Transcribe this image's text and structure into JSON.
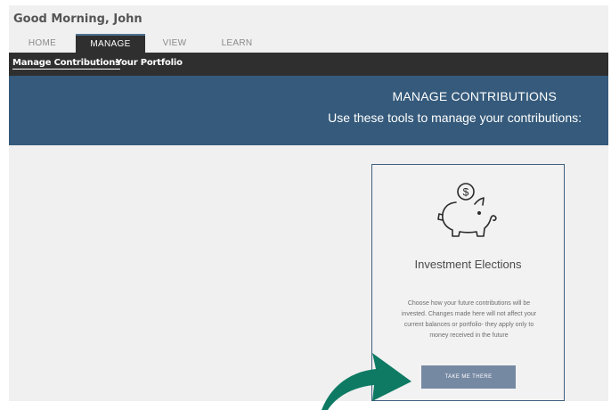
{
  "header": {
    "greeting": "Good Morning, John"
  },
  "tabs": [
    {
      "label": "HOME"
    },
    {
      "label": "MANAGE",
      "active": true
    },
    {
      "label": "VIEW"
    },
    {
      "label": "LEARN"
    }
  ],
  "subnav": [
    {
      "label": "Manage Contributions",
      "active": true
    },
    {
      "label": "Your Portfolio"
    }
  ],
  "banner": {
    "title": "MANAGE CONTRIBUTIONS",
    "subtitle": "Use these tools to manage your contributions:"
  },
  "card": {
    "icon": "piggy-bank-icon",
    "title": "Investment Elections",
    "description": "Choose how your future contributions will be invested. Changes made here will not affect your current balances or portfolio- they apply only to money received in the future",
    "button_label": "TAKE ME THERE"
  },
  "annotation": {
    "icon": "curved-arrow-icon",
    "color": "#0e7a63"
  },
  "colors": {
    "banner": "#355a7b",
    "nav_dark": "#2f2f2f",
    "button": "#7689a3",
    "card_border": "#3e5f7e"
  }
}
